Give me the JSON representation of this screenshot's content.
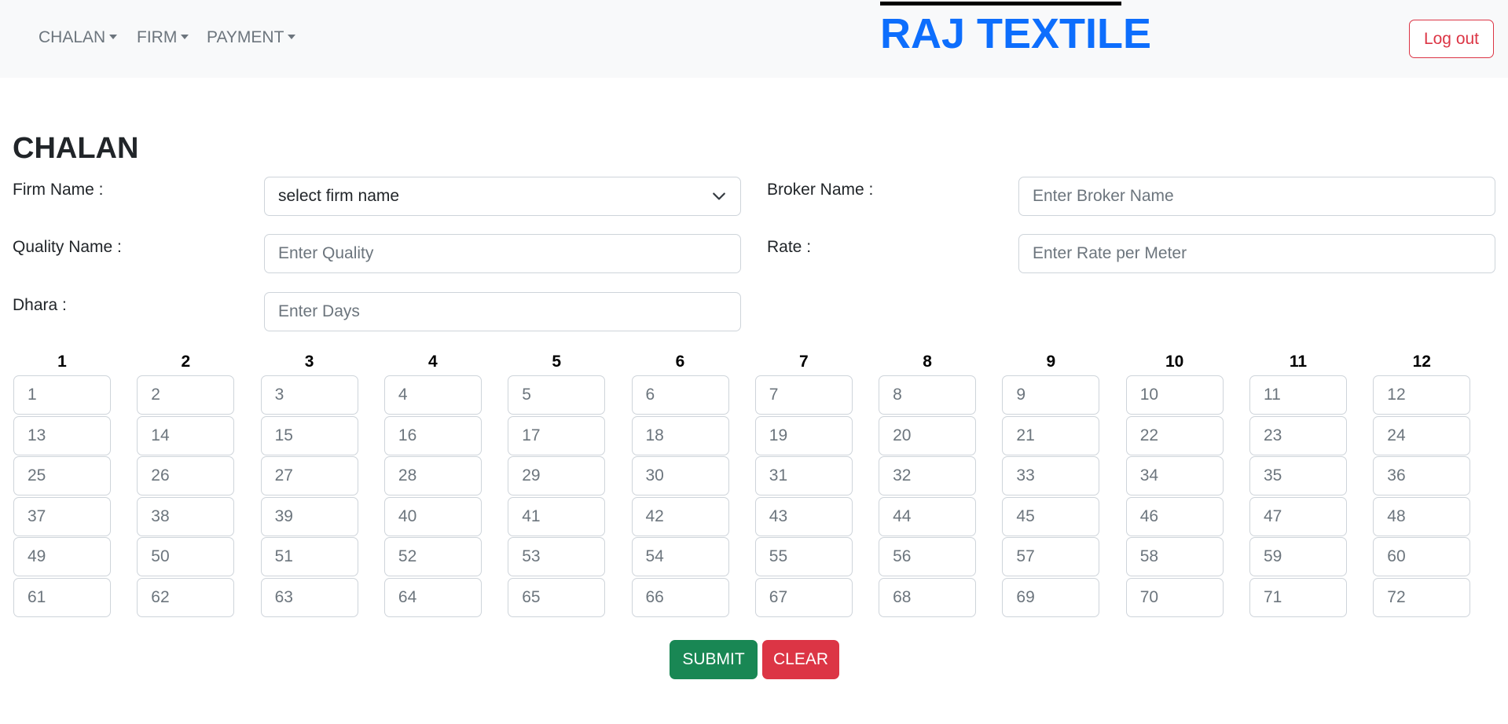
{
  "nav": {
    "menus": [
      {
        "label": "CHALAN"
      },
      {
        "label": "FIRM"
      },
      {
        "label": "PAYMENT"
      }
    ],
    "brand": "RAJ TEXTILE",
    "logout_label": "Log out"
  },
  "form": {
    "title": "CHALAN",
    "firm_label": "Firm Name :",
    "firm_selected": "select firm name",
    "broker_label": "Broker Name :",
    "broker_placeholder": "Enter Broker Name",
    "quality_label": "Quality Name :",
    "quality_placeholder": "Enter Quality",
    "rate_label": "Rate :",
    "rate_placeholder": "Enter Rate per Meter",
    "dhara_label": "Dhara :",
    "dhara_placeholder": "Enter Days"
  },
  "grid": {
    "columns": [
      "1",
      "2",
      "3",
      "4",
      "5",
      "6",
      "7",
      "8",
      "9",
      "10",
      "11",
      "12"
    ],
    "cells": [
      [
        "1",
        "2",
        "3",
        "4",
        "5",
        "6",
        "7",
        "8",
        "9",
        "10",
        "11",
        "12"
      ],
      [
        "13",
        "14",
        "15",
        "16",
        "17",
        "18",
        "19",
        "20",
        "21",
        "22",
        "23",
        "24"
      ],
      [
        "25",
        "26",
        "27",
        "28",
        "29",
        "30",
        "31",
        "32",
        "33",
        "34",
        "35",
        "36"
      ],
      [
        "37",
        "38",
        "39",
        "40",
        "41",
        "42",
        "43",
        "44",
        "45",
        "46",
        "47",
        "48"
      ],
      [
        "49",
        "50",
        "51",
        "52",
        "53",
        "54",
        "55",
        "56",
        "57",
        "58",
        "59",
        "60"
      ],
      [
        "61",
        "62",
        "63",
        "64",
        "65",
        "66",
        "67",
        "68",
        "69",
        "70",
        "71",
        "72"
      ]
    ]
  },
  "actions": {
    "submit_label": "SUBMIT",
    "clear_label": "CLEAR"
  },
  "colors": {
    "brand": "#0d6efd",
    "submit": "#198754",
    "danger": "#dc3545",
    "navbar_bg": "#f8f9fa"
  }
}
